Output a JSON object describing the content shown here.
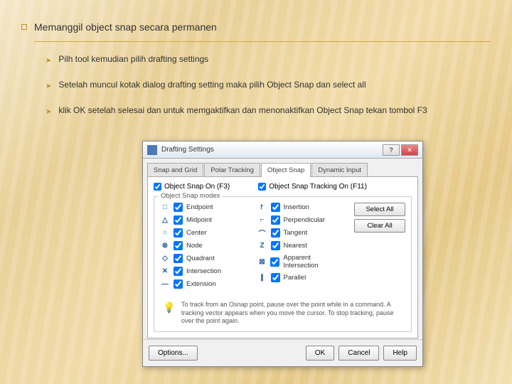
{
  "slide": {
    "heading": "Memanggil object snap secara permanen",
    "bullets": [
      "Pilh tool kemudian pilih drafting settings",
      "Setelah muncul kotak dialog drafting setting maka pilih Object Snap dan select all",
      "klik  OK  setelah selesai  dan untuk memgaktifkan dan menonaktifkan Object Snap tekan tombol F3"
    ]
  },
  "dialog": {
    "title": "Drafting Settings",
    "tabs": [
      "Snap and Grid",
      "Polar Tracking",
      "Object Snap",
      "Dynamic Input"
    ],
    "top_checks": {
      "left": "Object Snap On (F3)",
      "right": "Object Snap Tracking On (F11)"
    },
    "group_label": "Object Snap modes",
    "left_modes": [
      {
        "sym": "□",
        "label": "Endpoint"
      },
      {
        "sym": "△",
        "label": "Midpoint"
      },
      {
        "sym": "○",
        "label": "Center"
      },
      {
        "sym": "⊗",
        "label": "Node"
      },
      {
        "sym": "◇",
        "label": "Quadrant"
      },
      {
        "sym": "✕",
        "label": "Intersection"
      },
      {
        "sym": "—",
        "label": "Extension"
      }
    ],
    "right_modes": [
      {
        "sym": "꜓",
        "label": "Insertion"
      },
      {
        "sym": "⌐",
        "label": "Perpendicular"
      },
      {
        "sym": "⌒",
        "label": "Tangent"
      },
      {
        "sym": "Z",
        "label": "Nearest"
      },
      {
        "sym": "⊠",
        "label": "Apparent Intersection"
      },
      {
        "sym": "∥",
        "label": "Parallel"
      }
    ],
    "btns": {
      "select_all": "Select All",
      "clear_all": "Clear All"
    },
    "tip": "To track from an Osnap point, pause over the point while in a command. A tracking vector appears when you move the cursor. To stop tracking, pause over the point again.",
    "bottom": {
      "options": "Options...",
      "ok": "OK",
      "cancel": "Cancel",
      "help": "Help"
    }
  }
}
